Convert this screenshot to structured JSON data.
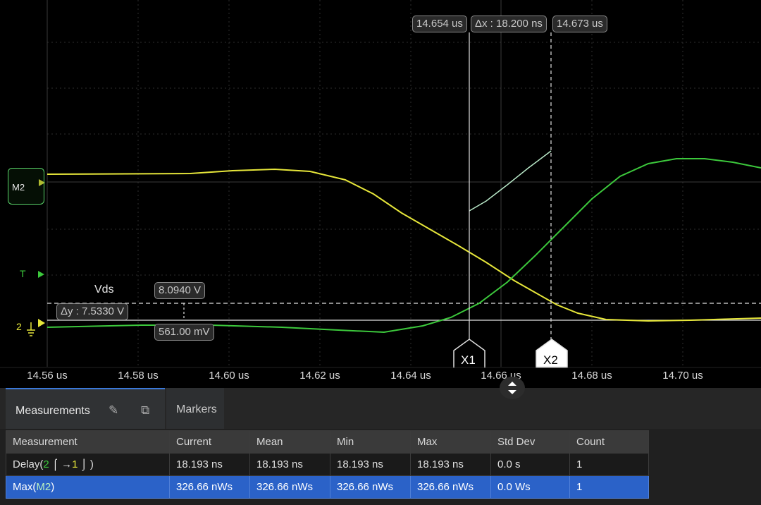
{
  "scope": {
    "x_axis": {
      "unit": "us",
      "ticks": [
        "14.56 us",
        "14.58 us",
        "14.60 us",
        "14.62 us",
        "14.64 us",
        "14.66 us",
        "14.68 us",
        "14.70 us"
      ]
    },
    "cursor_x1_time": "14.654 us",
    "cursor_x2_time": "14.673 us",
    "delta_x": "Δx : 18.200 ns",
    "cursor_x1_label": "X1",
    "cursor_x2_label": "X2",
    "channel_label": "Vds",
    "y_cursor_upper": "8.0940 V",
    "y_cursor_lower": "561.00 mV",
    "delta_y": "Δy : 7.5330 V",
    "math_marker": "M2",
    "trigger_marker": "T",
    "channel_marker": "2",
    "colors": {
      "yellow": "#e6e63a",
      "green": "#3cc83c",
      "math": "#b8e8c8",
      "grid": "#333"
    }
  },
  "panel": {
    "tabs": [
      "Measurements",
      "Markers"
    ],
    "edit_icon": "pencil-icon",
    "popout_icon": "popout-icon",
    "columns": [
      "Measurement",
      "Current",
      "Mean",
      "Min",
      "Max",
      "Std Dev",
      "Count"
    ],
    "rows": [
      {
        "name_prefix": "Delay(",
        "ch_a": "2",
        "arrow": "→",
        "ch_b": "1",
        "name_suffix": ")",
        "current": "18.193 ns",
        "mean": "18.193 ns",
        "min": "18.193 ns",
        "max": "18.193 ns",
        "std": "0.0 s",
        "count": "1"
      },
      {
        "name_prefix": "Max(",
        "ch_a": "M2",
        "name_suffix": ")",
        "current": "326.66 nWs",
        "mean": "326.66 nWs",
        "min": "326.66 nWs",
        "max": "326.66 nWs",
        "std": "0.0 Ws",
        "count": "1"
      }
    ]
  }
}
